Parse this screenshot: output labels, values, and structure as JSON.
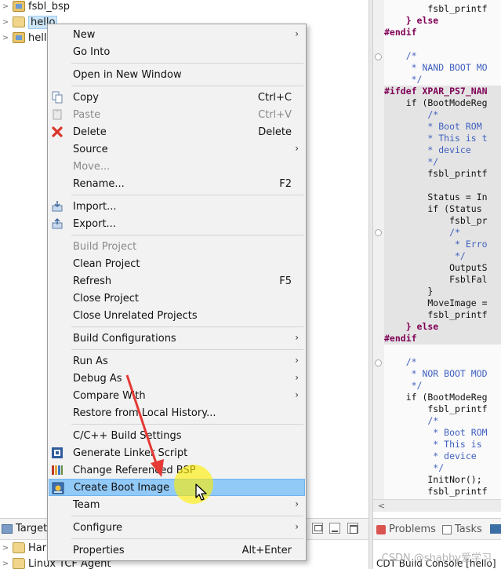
{
  "explorer": {
    "items": [
      {
        "label": "fsbl_bsp",
        "arrow": ">",
        "icon": "bsp-project-icon"
      },
      {
        "label": "hello",
        "arrow": ">",
        "icon": "open-folder-icon"
      },
      {
        "label": "hell",
        "arrow": ">",
        "icon": "bsp-project-icon"
      }
    ]
  },
  "editor": {
    "lines": [
      {
        "text": "        fsbl_printf",
        "type": "normal"
      },
      {
        "text": "    } else",
        "type": "kw"
      },
      {
        "text": "#endif",
        "type": "pre"
      },
      {
        "text": "",
        "type": "normal"
      },
      {
        "text": "    /*",
        "type": "com"
      },
      {
        "text": "     * NAND BOOT MO",
        "type": "com"
      },
      {
        "text": "     */",
        "type": "com"
      },
      {
        "text": "#ifdef XPAR_PS7_NAN",
        "type": "pre_hl"
      },
      {
        "text": "    if (BootModeReg",
        "type": "hl"
      },
      {
        "text": "        /*",
        "type": "com_hl"
      },
      {
        "text": "        * Boot ROM",
        "type": "com_hl"
      },
      {
        "text": "        * This is t",
        "type": "com_hl"
      },
      {
        "text": "        * device",
        "type": "com_hl"
      },
      {
        "text": "        */",
        "type": "com_hl"
      },
      {
        "text": "        fsbl_printf",
        "type": "hl"
      },
      {
        "text": "",
        "type": "hl"
      },
      {
        "text": "        Status = In",
        "type": "hl"
      },
      {
        "text": "        if (Status",
        "type": "hl"
      },
      {
        "text": "            fsbl_pr",
        "type": "hl"
      },
      {
        "text": "            /*",
        "type": "com_hl"
      },
      {
        "text": "             * Erro",
        "type": "com_hl"
      },
      {
        "text": "             */",
        "type": "com_hl"
      },
      {
        "text": "            OutputS",
        "type": "hl"
      },
      {
        "text": "            FsblFal",
        "type": "hl"
      },
      {
        "text": "        }",
        "type": "hl"
      },
      {
        "text": "        MoveImage =",
        "type": "hl"
      },
      {
        "text": "        fsbl_printf",
        "type": "hl"
      },
      {
        "text": "    } else",
        "type": "kw_hl"
      },
      {
        "text": "#endif",
        "type": "pre_hl"
      },
      {
        "text": "",
        "type": "normal"
      },
      {
        "text": "    /*",
        "type": "com"
      },
      {
        "text": "     * NOR BOOT MOD",
        "type": "com"
      },
      {
        "text": "     */",
        "type": "com"
      },
      {
        "text": "    if (BootModeReg",
        "type": "normal"
      },
      {
        "text": "        fsbl_printf",
        "type": "normal"
      },
      {
        "text": "        /*",
        "type": "com"
      },
      {
        "text": "         * Boot ROM",
        "type": "com"
      },
      {
        "text": "         * This is",
        "type": "com"
      },
      {
        "text": "         * device",
        "type": "com"
      },
      {
        "text": "         */",
        "type": "com"
      },
      {
        "text": "        InitNor();",
        "type": "normal"
      },
      {
        "text": "        fsbl_printf",
        "type": "normal"
      }
    ]
  },
  "menu": {
    "items": [
      {
        "label": "New",
        "accel": "",
        "submenu": true,
        "disabled": false,
        "icon": ""
      },
      {
        "label": "Go Into",
        "accel": "",
        "submenu": false,
        "disabled": false,
        "icon": ""
      },
      {
        "sep": true
      },
      {
        "label": "Open in New Window",
        "accel": "",
        "submenu": false,
        "disabled": false,
        "icon": ""
      },
      {
        "sep": true
      },
      {
        "label": "Copy",
        "accel": "Ctrl+C",
        "submenu": false,
        "disabled": false,
        "icon": "copy-icon"
      },
      {
        "label": "Paste",
        "accel": "Ctrl+V",
        "submenu": false,
        "disabled": true,
        "icon": "paste-icon"
      },
      {
        "label": "Delete",
        "accel": "Delete",
        "submenu": false,
        "disabled": false,
        "icon": "delete-icon"
      },
      {
        "label": "Source",
        "accel": "",
        "submenu": true,
        "disabled": false,
        "icon": ""
      },
      {
        "label": "Move...",
        "accel": "",
        "submenu": false,
        "disabled": true,
        "icon": ""
      },
      {
        "label": "Rename...",
        "accel": "F2",
        "submenu": false,
        "disabled": false,
        "icon": ""
      },
      {
        "sep": true
      },
      {
        "label": "Import...",
        "accel": "",
        "submenu": false,
        "disabled": false,
        "icon": "import-icon"
      },
      {
        "label": "Export...",
        "accel": "",
        "submenu": false,
        "disabled": false,
        "icon": "export-icon"
      },
      {
        "sep": true
      },
      {
        "label": "Build Project",
        "accel": "",
        "submenu": false,
        "disabled": true,
        "icon": ""
      },
      {
        "label": "Clean Project",
        "accel": "",
        "submenu": false,
        "disabled": false,
        "icon": ""
      },
      {
        "label": "Refresh",
        "accel": "F5",
        "submenu": false,
        "disabled": false,
        "icon": ""
      },
      {
        "label": "Close Project",
        "accel": "",
        "submenu": false,
        "disabled": false,
        "icon": ""
      },
      {
        "label": "Close Unrelated Projects",
        "accel": "",
        "submenu": false,
        "disabled": false,
        "icon": ""
      },
      {
        "sep": true
      },
      {
        "label": "Build Configurations",
        "accel": "",
        "submenu": true,
        "disabled": false,
        "icon": ""
      },
      {
        "sep": true
      },
      {
        "label": "Run As",
        "accel": "",
        "submenu": true,
        "disabled": false,
        "icon": ""
      },
      {
        "label": "Debug As",
        "accel": "",
        "submenu": true,
        "disabled": false,
        "icon": ""
      },
      {
        "label": "Compare With",
        "accel": "",
        "submenu": true,
        "disabled": false,
        "icon": ""
      },
      {
        "label": "Restore from Local History...",
        "accel": "",
        "submenu": false,
        "disabled": false,
        "icon": ""
      },
      {
        "sep": true
      },
      {
        "label": "C/C++ Build Settings",
        "accel": "",
        "submenu": false,
        "disabled": false,
        "icon": ""
      },
      {
        "label": "Generate Linker Script",
        "accel": "",
        "submenu": false,
        "disabled": false,
        "icon": "linker-script-icon"
      },
      {
        "label": "Change Referenced BSP",
        "accel": "",
        "submenu": false,
        "disabled": false,
        "icon": "bsp-icon"
      },
      {
        "label": "Create Boot Image",
        "accel": "",
        "submenu": false,
        "disabled": false,
        "icon": "boot-image-icon",
        "selected": true
      },
      {
        "label": "Team",
        "accel": "",
        "submenu": true,
        "disabled": false,
        "icon": ""
      },
      {
        "sep": true
      },
      {
        "label": "Configure",
        "accel": "",
        "submenu": true,
        "disabled": false,
        "icon": ""
      },
      {
        "sep": true
      },
      {
        "label": "Properties",
        "accel": "Alt+Enter",
        "submenu": false,
        "disabled": false,
        "icon": ""
      }
    ]
  },
  "bottom_left": {
    "tab_label": "Target",
    "tree_items": [
      {
        "label": "Har",
        "arrow": ">"
      },
      {
        "label": "Linux TCF Agent",
        "arrow": ">"
      }
    ]
  },
  "bottom_right": {
    "tabs": [
      {
        "label": "Problems",
        "icon": "problems-icon"
      },
      {
        "label": "Tasks",
        "icon": "tasks-icon"
      }
    ],
    "console_title": "CDT Build Console [hello]"
  },
  "watermark": "CSDN @shabby爱学习",
  "colors": {
    "selection": "#91c9f7",
    "menu_bg": "#f2f2f2",
    "preprocessor": "#7f0055",
    "comment": "#3f5fbf",
    "highlight_blob": "#ffef00",
    "arrow": "#e53935"
  }
}
